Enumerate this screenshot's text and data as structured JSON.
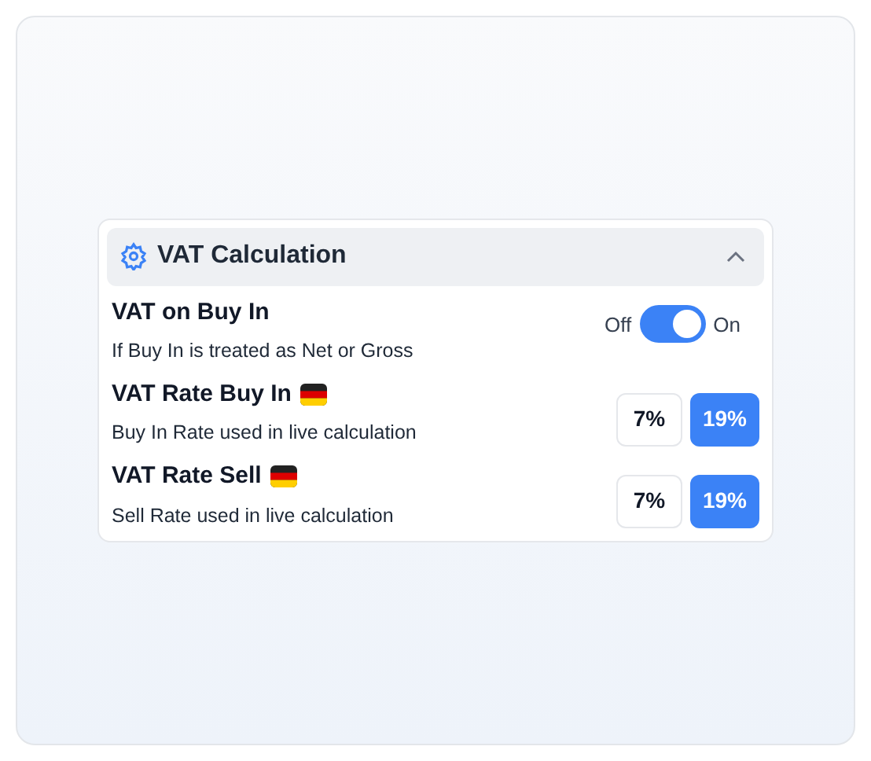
{
  "section": {
    "title": "VAT Calculation",
    "expanded": true
  },
  "rows": [
    {
      "kind": "toggle",
      "label": "VAT on Buy In",
      "flag": false,
      "description": "If Buy In is treated as Net or Gross",
      "off_label": "Off",
      "on_label": "On",
      "on": true
    },
    {
      "kind": "options",
      "label": "VAT Rate Buy In",
      "flag": true,
      "description": "Buy In Rate used in live calculation",
      "options": [
        {
          "label": "7%",
          "selected": false
        },
        {
          "label": "19%",
          "selected": true
        }
      ]
    },
    {
      "kind": "options",
      "label": "VAT Rate Sell",
      "flag": true,
      "description": "Sell Rate used in live calculation",
      "options": [
        {
          "label": "7%",
          "selected": false
        },
        {
          "label": "19%",
          "selected": true
        }
      ]
    }
  ]
}
